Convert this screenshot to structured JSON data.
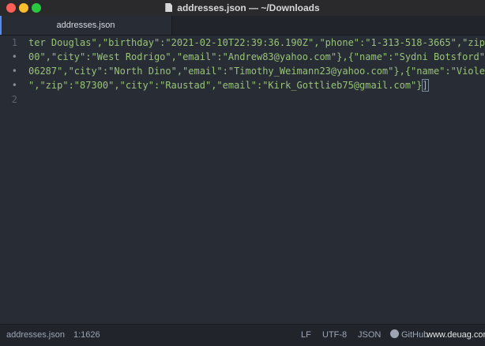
{
  "window": {
    "title": "addresses.json — ~/Downloads"
  },
  "tab": {
    "label": "addresses.json"
  },
  "gutter": {
    "line1": "1",
    "fold1": "•",
    "fold2": "•",
    "fold3": "•",
    "line2": "2"
  },
  "code": {
    "row1": "ter Douglas\",\"birthday\":\"2021-02-10T22:39:36.190Z\",\"phone\":\"1-313-518-3665\",\"zip\":\"",
    "row2": "00\",\"city\":\"West Rodrigo\",\"email\":\"Andrew83@yahoo.com\"},{\"name\":\"Sydni Botsford\",\"b",
    "row3": "06287\",\"city\":\"North Dino\",\"email\":\"Timothy_Weimann23@yahoo.com\"},{\"name\":\"Violette",
    "row4": "\",\"zip\":\"87300\",\"city\":\"Raustad\",\"email\":\"Kirk_Gottlieb75@gmail.com\"}",
    "row4_close": "]"
  },
  "status": {
    "file": "addresses.json",
    "position": "1:1626",
    "line_ending": "LF",
    "encoding": "UTF-8",
    "grammar": "JSON",
    "github": "GitHub",
    "watermark": "www.deuag.com"
  },
  "colors": {
    "accent": "#568af2",
    "string": "#98c379",
    "background": "#282c34"
  },
  "icons": {
    "title": "document-icon",
    "github": "github-icon"
  }
}
